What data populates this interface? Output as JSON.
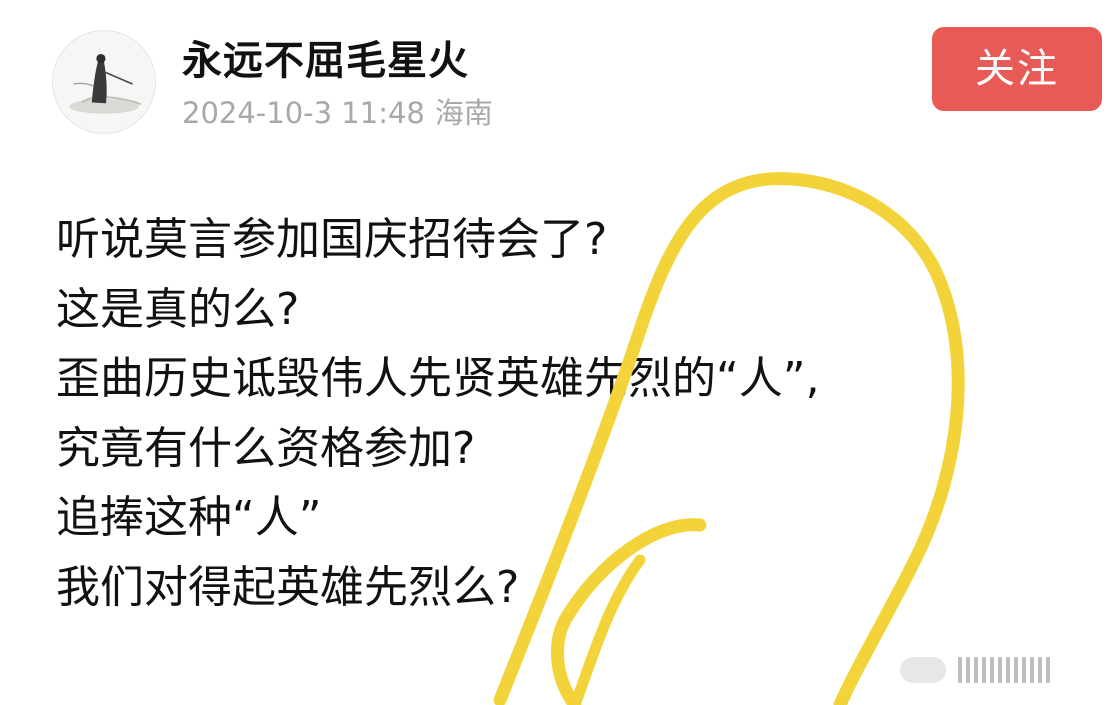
{
  "post": {
    "author": {
      "name": "永远不屈毛星火"
    },
    "timestamp": "2024-10-3 11:48",
    "location": "海南",
    "follow_label": "关注",
    "lines": [
      "听说莫言参加国庆招待会了?",
      "这是真的么?",
      "歪曲历史诋毁伟人先贤英雄先烈的“人”,",
      "究竟有什么资格参加?",
      "追捧这种“人”",
      "我们对得起英雄先烈么?"
    ]
  },
  "colors": {
    "follow_button": "#e85a55",
    "highlight_stroke": "#f2d43a",
    "meta_text": "#a8a8a8"
  },
  "icons": {
    "avatar": "ink-painting-figure-avatar"
  }
}
